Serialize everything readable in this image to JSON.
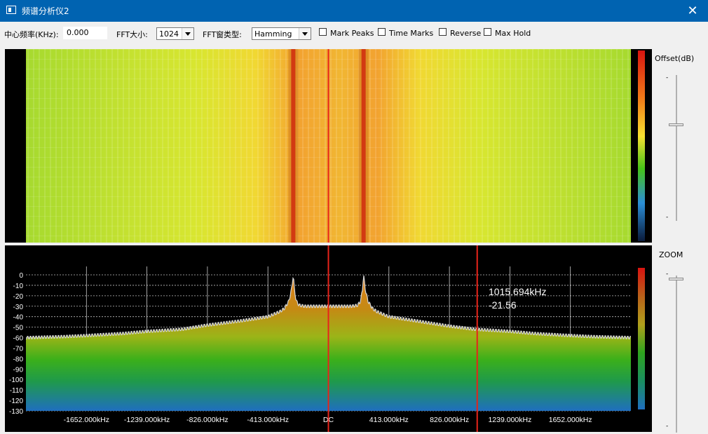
{
  "window": {
    "title": "频谱分析仪2",
    "close_label": "✕"
  },
  "toolbar": {
    "center_freq_label": "中心频率(KHz):",
    "center_freq_value": "0.000",
    "fft_size_label": "FFT大小:",
    "fft_size_value": "1024",
    "fft_window_label": "FFT窗类型:",
    "fft_window_value": "Hamming",
    "mark_peaks_label": "Mark Peaks",
    "time_marks_label": "Time Marks",
    "reverse_label": "Reverse",
    "max_hold_label": "Max Hold",
    "mark_peaks_checked": false,
    "time_marks_checked": false,
    "reverse_checked": false,
    "max_hold_checked": false
  },
  "side": {
    "offset_label": "Offset(dB)",
    "zoom_label": "ZOOM",
    "offset_tick_top": "-",
    "offset_tick_bottom": "-",
    "zoom_tick_top": "-",
    "zoom_tick_bottom": "-"
  },
  "colors": {
    "titlebar": "#0063b1",
    "marker": "#e8231a",
    "waterfall_base": "#f2e43a",
    "peak": "#d23a12",
    "spectrum_top": "#d07a1a",
    "spectrum_mid": "#3bb419",
    "spectrum_bottom": "#1f6fbf"
  },
  "cursor_readout": {
    "freq": "1015.694kHz",
    "level": "-21.56"
  },
  "chart_data": {
    "type": "area",
    "title": "",
    "xlabel": "",
    "ylabel": "",
    "ylim": [
      -130,
      0
    ],
    "y_ticks": [
      "0",
      "-10",
      "-20",
      "-30",
      "-40",
      "-50",
      "-60",
      "-70",
      "-80",
      "-90",
      "-100",
      "-110",
      "-120",
      "-130"
    ],
    "x_ticks": [
      "-1652.000kHz",
      "-1239.000kHz",
      "-826.000kHz",
      "-413.000kHz",
      "DC",
      "413.000kHz",
      "826.000kHz",
      "1239.000kHz",
      "1652.000kHz"
    ],
    "x_tick_khz": [
      -1652,
      -1239,
      -826,
      -413,
      0,
      413,
      826,
      1239,
      1652
    ],
    "xlim_khz": [
      -2065,
      2065
    ],
    "markers_khz": [
      0,
      1015.694
    ],
    "series": [
      {
        "x_khz": [
          -2065,
          -1800,
          -1652,
          -1400,
          -1239,
          -1000,
          -826,
          -600,
          -413,
          -330,
          -300,
          -270,
          -252,
          -240,
          -232,
          -220,
          -200,
          -160,
          -100,
          -50,
          0,
          50,
          100,
          160,
          200,
          220,
          232,
          240,
          252,
          270,
          300,
          330,
          413,
          600,
          826,
          1000,
          1239,
          1400,
          1652,
          1800,
          2065
        ],
        "values": [
          -60,
          -59,
          -58,
          -56,
          -54,
          -52,
          -48,
          -44,
          -40,
          -35,
          -32,
          -25,
          -14,
          0,
          -14,
          -25,
          -29,
          -30,
          -30,
          -30,
          -30,
          -30,
          -30,
          -30,
          -29,
          -25,
          -14,
          0,
          -14,
          -25,
          -32,
          -35,
          -40,
          -44,
          -49,
          -52,
          -54,
          -56,
          -58,
          -59,
          -60
        ]
      }
    ]
  }
}
